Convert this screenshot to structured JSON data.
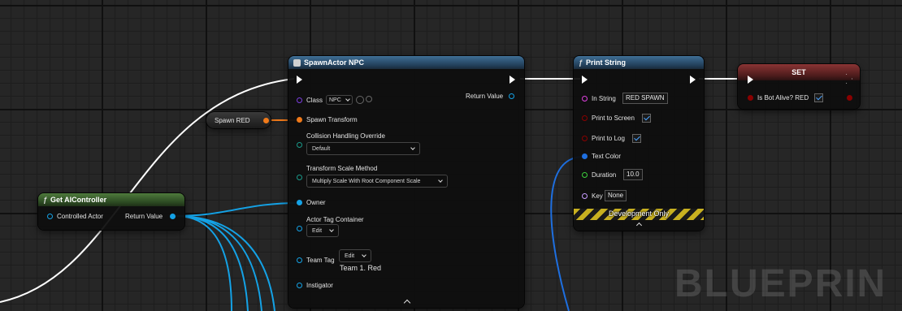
{
  "colors": {
    "exec": "#ffffff",
    "object": "#14a2e6",
    "struct": "#f07a1a",
    "bool": "#8a0000",
    "string": "#e040e0",
    "float": "#3cd03c",
    "class": "#7b3ee0",
    "name": "#c79cff",
    "linear_color": "#1e6fe0"
  },
  "spawn_actor": {
    "title": "SpawnActor NPC",
    "class_label": "Class",
    "class_value": "NPC",
    "return_value": "Return Value",
    "spawn_transform": "Spawn Transform",
    "collision_label": "Collision Handling Override",
    "collision_value": "Default",
    "scale_label": "Transform Scale Method",
    "scale_value": "Multiply Scale With Root Component Scale",
    "owner": "Owner",
    "tag_container_label": "Actor Tag Container",
    "tag_container_value": "Edit",
    "team_tag_label": "Team Tag",
    "team_tag_edit": "Edit",
    "team_tag_value": "Team 1. Red",
    "instigator": "Instigator"
  },
  "spawn_red": {
    "label": "Spawn RED"
  },
  "get_ai_controller": {
    "title": "Get AIController",
    "input": "Controlled Actor",
    "output": "Return Value"
  },
  "print_string": {
    "title": "Print String",
    "in_string_label": "In String",
    "in_string_value": "RED SPAWN",
    "print_screen": "Print to Screen",
    "print_log": "Print to Log",
    "text_color": "Text Color",
    "duration_label": "Duration",
    "duration_value": "10.0",
    "key_label": "Key",
    "key_value": "None",
    "dev_only": "Development Only"
  },
  "set_node": {
    "title": "SET",
    "var_label": "Is Bot Alive? RED"
  },
  "watermark": "BLUEPRIN"
}
